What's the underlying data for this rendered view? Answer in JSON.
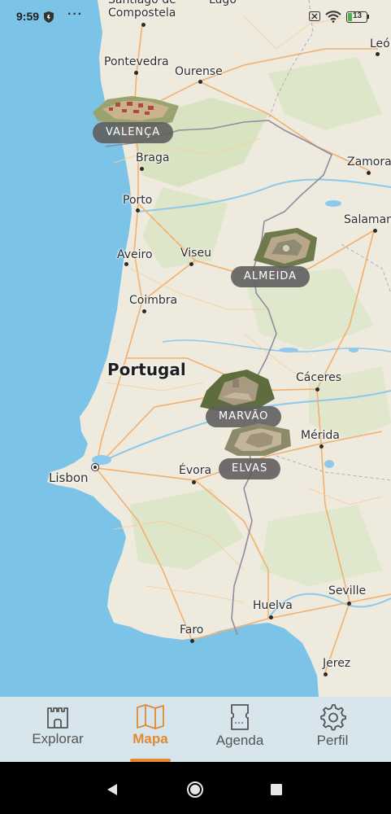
{
  "status_bar": {
    "time": "9:59",
    "more_label": "···",
    "battery_level": "13"
  },
  "map": {
    "colors": {
      "sea": "#7cc3e8",
      "land": "#eeeadd",
      "green": "#c8dcb0",
      "road": "#f2b070",
      "border": "#8e8ca0"
    },
    "country_label": "Portugal",
    "cities": [
      {
        "name": "Santiago de",
        "role": "cut-top"
      },
      {
        "name": "Compostela"
      },
      {
        "name": "Lugo"
      },
      {
        "name": "León"
      },
      {
        "name": "Pontevedra"
      },
      {
        "name": "Ourense"
      },
      {
        "name": "Braga"
      },
      {
        "name": "Zamora"
      },
      {
        "name": "Porto"
      },
      {
        "name": "Salamanca"
      },
      {
        "name": "Aveiro"
      },
      {
        "name": "Viseu"
      },
      {
        "name": "Coimbra"
      },
      {
        "name": "Cáceres"
      },
      {
        "name": "Mérida"
      },
      {
        "name": "Lisbon"
      },
      {
        "name": "Évora"
      },
      {
        "name": "Seville"
      },
      {
        "name": "Huelva"
      },
      {
        "name": "Faro"
      },
      {
        "name": "Jerez"
      }
    ],
    "fortresses": [
      {
        "name": "VALENÇA"
      },
      {
        "name": "ALMEIDA"
      },
      {
        "name": "MARVÃO"
      },
      {
        "name": "ELVAS"
      }
    ]
  },
  "tabbar": {
    "tabs": [
      {
        "label": "Explorar",
        "icon": "castle-icon",
        "active": false
      },
      {
        "label": "Mapa",
        "icon": "map-icon",
        "active": true
      },
      {
        "label": "Agenda",
        "icon": "ticket-icon",
        "active": false
      },
      {
        "label": "Perfil",
        "icon": "gear-icon",
        "active": false
      }
    ],
    "active_color": "#e08a33"
  },
  "nav_bar": {
    "buttons": [
      "back-icon",
      "home-icon",
      "recents-icon"
    ]
  }
}
